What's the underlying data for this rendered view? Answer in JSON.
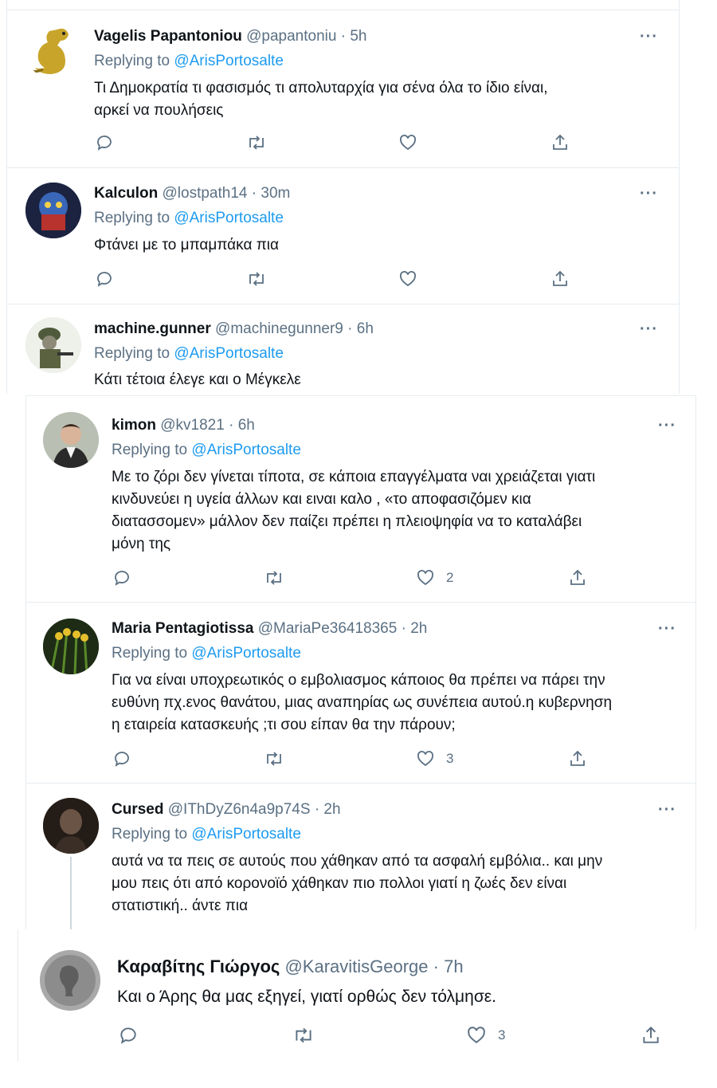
{
  "tweets": [
    {
      "name": "Vagelis Papantoniou",
      "handle": "@papantoniu",
      "time": "5h",
      "replying_prefix": "Replying to",
      "replying_handle": "@ArisPortosalte",
      "text": [
        "Τι Δημοκρατία τι φασισμός τι απολυταρχία για σένα όλα το ίδιο είναι,",
        "αρκεί να  πουλήσεις"
      ],
      "likes": "",
      "avatar": "dinosaur-avatar"
    },
    {
      "name": "Kalculon",
      "handle": "@lostpath14",
      "time": "30m",
      "replying_prefix": "Replying to",
      "replying_handle": "@ArisPortosalte",
      "text": [
        "Φτάνει με το μπαμπάκα πια"
      ],
      "likes": "",
      "avatar": "robot-avatar"
    },
    {
      "name": "machine.gunner",
      "handle": "@machinegunner9",
      "time": "6h",
      "replying_prefix": "Replying to",
      "replying_handle": "@ArisPortosalte",
      "text": [
        "Κάτι τέτοια έλεγε και ο Μέγκελε"
      ],
      "likes": "",
      "avatar": "soldier-avatar"
    },
    {
      "name": "kimon",
      "handle": "@kv1821",
      "time": "6h",
      "replying_prefix": "Replying to",
      "replying_handle": "@ArisPortosalte",
      "text": [
        "Με το ζόρι δεν γίνεται τίποτα, σε κάποια επαγγέλματα ναι χρειάζεται γιατι",
        "κινδυνεύει η υγεία άλλων και ειναι καλο , «το αποφασιζόμεν κια",
        "διατασσομεν» μάλλον δεν παίζει πρέπει η πλειοψηφία  να το καταλάβει",
        "μόνη της"
      ],
      "likes": "2",
      "avatar": "person-avatar"
    },
    {
      "name": "Maria Pentagiotissa",
      "handle": "@MariaPe36418365",
      "time": "2h",
      "replying_prefix": "Replying to",
      "replying_handle": "@ArisPortosalte",
      "text": [
        "Για να είναι υποχρεωτικός ο εμβολιασμος κάποιος θα πρέπει να πάρει την",
        "ευθύνη πχ.ενος θανάτου, μιας αναπηρίας ως συνέπεια αυτού.η κυβερνηση",
        "η εταιρεία κατασκευής ;τι σου είπαν θα την πάρουν;"
      ],
      "likes": "3",
      "avatar": "flowers-avatar"
    },
    {
      "name": "Cursed",
      "handle": "@IThDyZ6n4a9p74S",
      "time": "2h",
      "replying_prefix": "Replying to",
      "replying_handle": "@ArisPortosalte",
      "text": [
        "αυτά να τα πεις σε αυτούς που χάθηκαν από τα ασφαλή εμβόλια.. και μην",
        "μου πεις ότι από κορονοϊό χάθηκαν πιο πολλοι γιατί η ζωές δεν είναι",
        "στατιστική.. άντε πια"
      ],
      "likes": "",
      "avatar": "dark-avatar"
    },
    {
      "name": "Καραβίτης Γιώργος",
      "handle": "@KaravitisGeorge",
      "time": "7h",
      "replying_prefix": "",
      "replying_handle": "",
      "text": [
        "Και ο Άρης θα μας εξηγεί, γιατί ορθώς δεν τόλμησε."
      ],
      "likes": "3",
      "avatar": "coin-avatar"
    }
  ],
  "separator": "·",
  "more_label": "···",
  "colors": {
    "accent": "#1d9bf0",
    "secondary": "#5b7083",
    "text": "#0f1419",
    "border": "#e6ecf0"
  }
}
